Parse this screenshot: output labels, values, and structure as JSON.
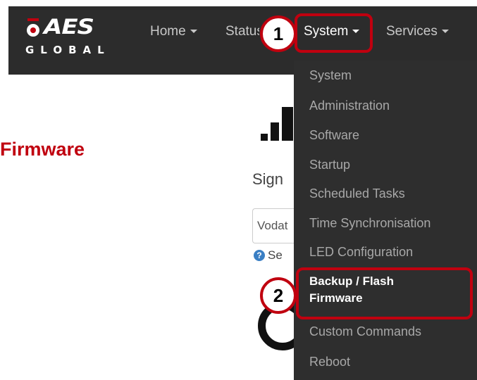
{
  "brand": {
    "logo_main": "AES",
    "logo_sub": "GLOBAL"
  },
  "nav": {
    "home": "Home",
    "status": "Status",
    "system": "System",
    "services": "Services"
  },
  "annotations": {
    "step1": "1",
    "step2": "2",
    "highlight_color": "#c0000f"
  },
  "system_menu": {
    "items": [
      "System",
      "Administration",
      "Software",
      "Startup",
      "Scheduled Tasks",
      "Time Synchronisation",
      "LED Configuration",
      "Backup / Flash Firmware",
      "Custom Commands",
      "Reboot"
    ],
    "active_line1": "Backup / Flash",
    "active_line2": "Firmware"
  },
  "side_label": "Firmware",
  "page": {
    "signal_text": "Sign",
    "select_value": "Vodat",
    "help_text": "Se"
  },
  "colors": {
    "navbar_bg": "#2c2c2c",
    "dropdown_bg": "#2e2e2e",
    "accent_red": "#c0000f"
  }
}
